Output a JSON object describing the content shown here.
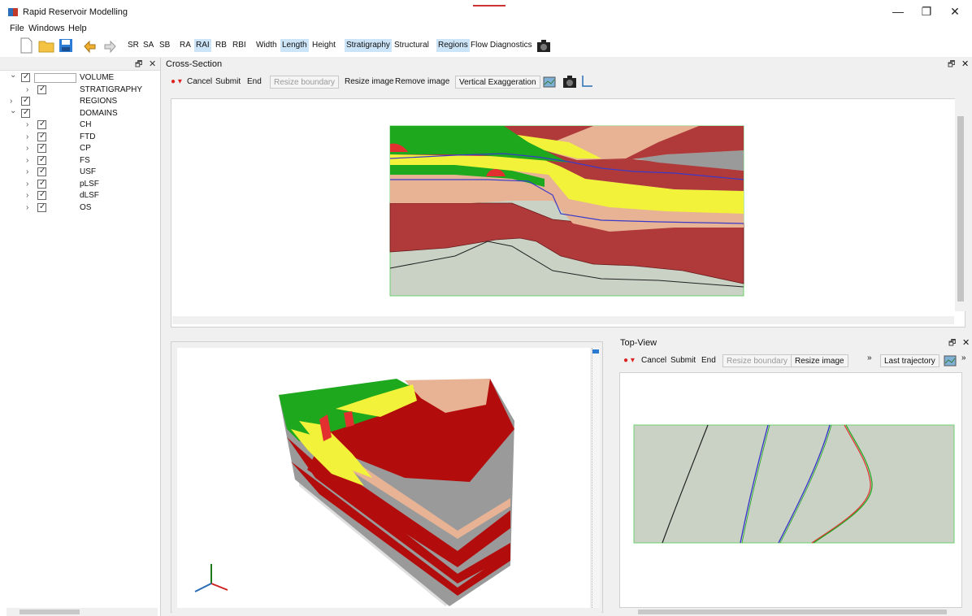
{
  "app": {
    "title": "Rapid Reservoir Modelling"
  },
  "window_controls": {
    "minimize": "—",
    "maximize": "❐",
    "close": "✕"
  },
  "menu": [
    "File",
    "Windows",
    "Help"
  ],
  "toolbar": {
    "sketch_modes": [
      "SR",
      "SA",
      "SB",
      "RA",
      "RAI",
      "RB",
      "RBI"
    ],
    "active_mode": "RAI",
    "dims": [
      "Width",
      "Length",
      "Height"
    ],
    "active_dim": "Length",
    "views": [
      "Stratigraphy",
      "Structural",
      "Regions",
      "Flow Diagnostics"
    ],
    "active_views": [
      "Stratigraphy",
      "Regions"
    ],
    "icons": [
      "new-file-icon",
      "open-folder-icon",
      "save-icon",
      "undo-icon",
      "redo-icon",
      "camera-icon"
    ]
  },
  "object_tree": {
    "dock_float": "🗗",
    "dock_close": "✕",
    "items": [
      {
        "label": "VOLUME",
        "level": 0,
        "expanded": true
      },
      {
        "label": "STRATIGRAPHY",
        "level": 1,
        "expanded": false
      },
      {
        "label": "REGIONS",
        "level": 0,
        "expanded": false
      },
      {
        "label": "DOMAINS",
        "level": 0,
        "expanded": true
      },
      {
        "label": "CH",
        "level": 1,
        "expanded": false
      },
      {
        "label": "FTD",
        "level": 1,
        "expanded": false
      },
      {
        "label": "CP",
        "level": 1,
        "expanded": false
      },
      {
        "label": "FS",
        "level": 1,
        "expanded": false
      },
      {
        "label": "USF",
        "level": 1,
        "expanded": false
      },
      {
        "label": "pLSF",
        "level": 1,
        "expanded": false
      },
      {
        "label": "dLSF",
        "level": 1,
        "expanded": false
      },
      {
        "label": "OS",
        "level": 1,
        "expanded": false
      }
    ]
  },
  "cross_section": {
    "title": "Cross-Section",
    "tools": {
      "cancel": "Cancel",
      "submit": "Submit",
      "end": "End",
      "resize_boundary": "Resize boundary",
      "resize_image": "Resize image",
      "remove_image": "Remove image",
      "vertical_exaggeration": "Vertical Exaggeration"
    }
  },
  "top_view": {
    "title": "Top-View",
    "tools": {
      "cancel": "Cancel",
      "submit": "Submit",
      "end": "End",
      "resize_boundary": "Resize boundary",
      "resize_image": "Resize image",
      "more": "»",
      "last_trajectory": "Last trajectory",
      "more2": "»"
    }
  },
  "colors": {
    "green": "#1ea81e",
    "yellow": "#f2f23a",
    "pale_yellow": "#eef29a",
    "salmon": "#e8b394",
    "dark_red": "#b03a3a",
    "crimson": "#b30c0c",
    "gray": "#9a9a9a",
    "sage": "#c9d2c4",
    "blue_line": "#3a3ac8"
  }
}
